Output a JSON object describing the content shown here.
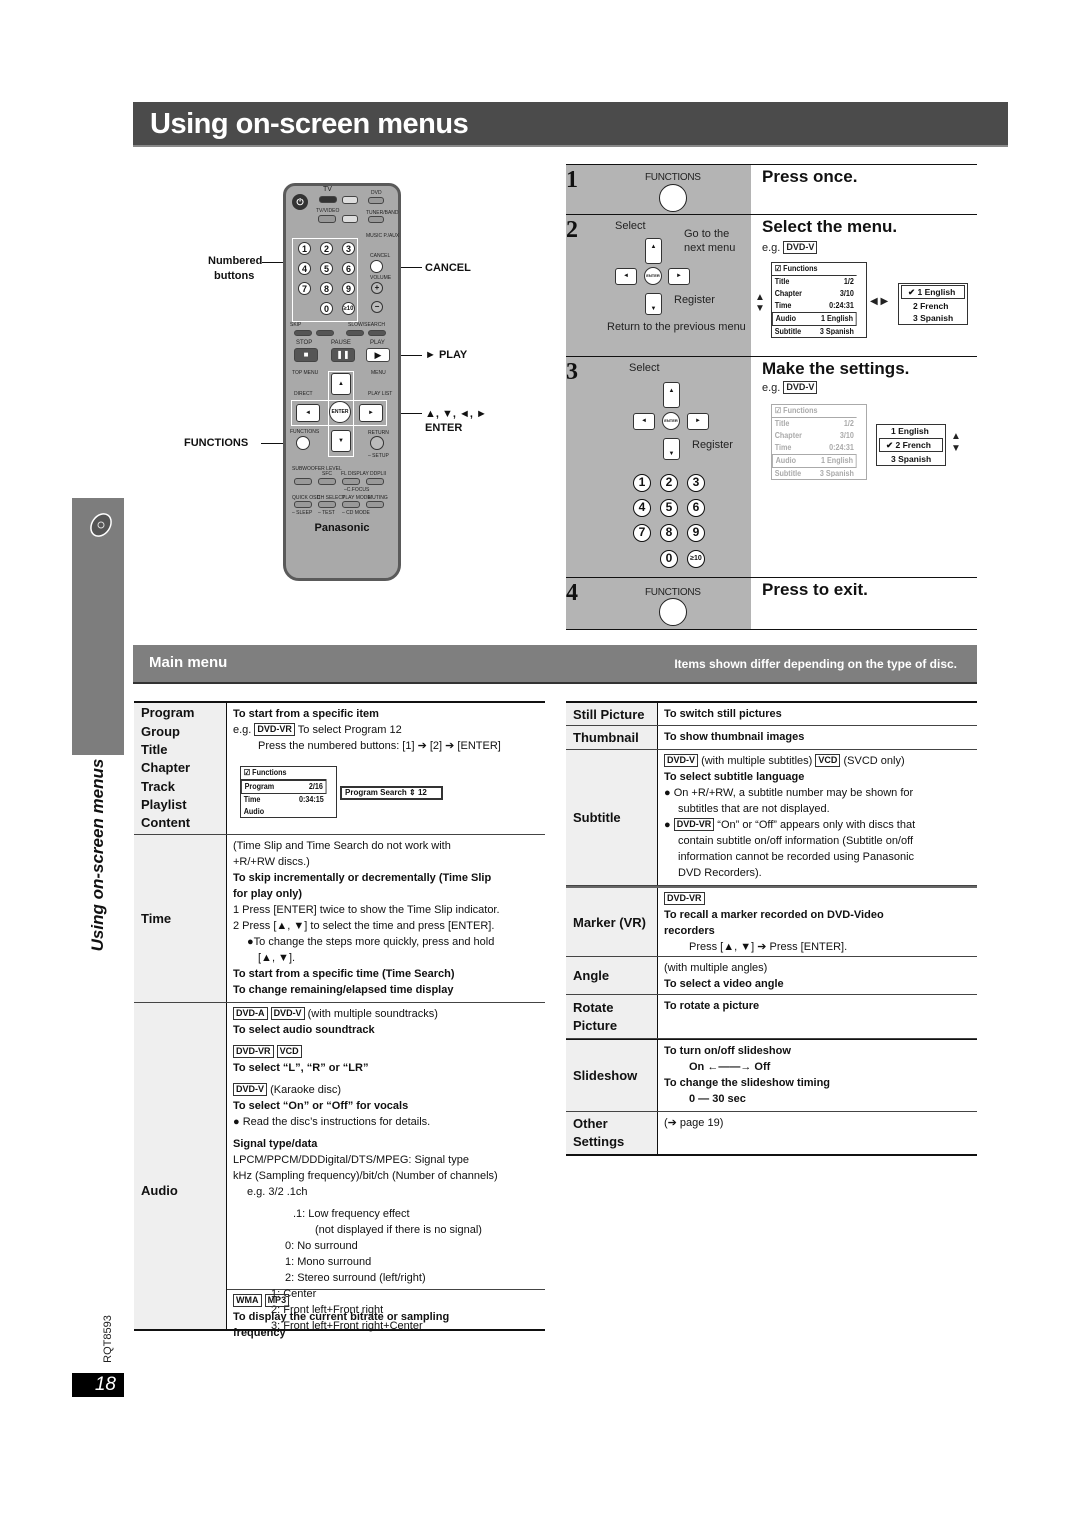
{
  "page": {
    "title": "Using on-screen menus",
    "side_label": "Using on-screen menus",
    "doc_code": "RQT8593",
    "page_number": "18"
  },
  "remote": {
    "callouts": {
      "numbered": "Numbered",
      "buttons": "buttons",
      "cancel": "CANCEL",
      "play": "► PLAY",
      "arrows": "▲, ▼, ◄, ►",
      "enter": "ENTER",
      "functions": "FUNCTIONS"
    },
    "brand": "Panasonic",
    "labels": {
      "tv": "TV",
      "dvd": "DVD",
      "tuner": "TUNER/BAND",
      "music": "MUSIC P./AUX",
      "cancel": "CANCEL",
      "volume": "VOLUME",
      "tvvideo": "TV/VIDEO",
      "skip": "SKIP",
      "slow": "SLOW/SEARCH",
      "stop": "STOP",
      "pause": "PAUSE",
      "play": "PLAY",
      "topmenu": "TOP MENU",
      "menu": "MENU",
      "direct": "DIRECT",
      "playlist": "PLAY LIST",
      "functions": "FUNCTIONS",
      "return": "RETURN",
      "setup": "– SETUP",
      "sub": "SUBWOOFER LEVEL",
      "sfc": "SFC",
      "fl": "FL DISPLAY",
      "pl2": "DDPLII",
      "cfocus": "–C.FOCUS",
      "quick": "QUICK OSD",
      "ch": "CH SELECT",
      "pmode": "PLAY MODE",
      "muting": "MUTING",
      "sleep": "– SLEEP",
      "test": "– TEST",
      "cdmode": "– CD MODE",
      "enter": "ENTER"
    },
    "digits": [
      "1",
      "2",
      "3",
      "4",
      "5",
      "6",
      "7",
      "8",
      "9",
      "0",
      "≥10"
    ]
  },
  "steps": [
    {
      "num": "1",
      "button": "FUNCTIONS",
      "title": "Press once."
    },
    {
      "num": "2",
      "title": "Select the menu.",
      "select": "Select",
      "go_next": "Go to the next menu",
      "register": "Register",
      "return_prev": "Return to the previous menu",
      "eg": "e.g.",
      "disc": "DVD-V",
      "osd": {
        "header": "Functions",
        "rows": [
          [
            "Title",
            "1/2"
          ],
          [
            "Chapter",
            "3/10"
          ],
          [
            "Time",
            "0:24:31"
          ],
          [
            "Audio",
            "1 English"
          ],
          [
            "Subtitle",
            "3 Spanish"
          ]
        ]
      },
      "options": [
        "✔ 1 English",
        "2 French",
        "3 Spanish"
      ]
    },
    {
      "num": "3",
      "title": "Make the settings.",
      "select": "Select",
      "register": "Register",
      "eg": "e.g.",
      "disc": "DVD-V",
      "options": [
        "1 English",
        "✔ 2 French",
        "3 Spanish"
      ],
      "digits": [
        "1",
        "2",
        "3",
        "4",
        "5",
        "6",
        "7",
        "8",
        "9",
        "0",
        "≥10"
      ]
    },
    {
      "num": "4",
      "button": "FUNCTIONS",
      "title": "Press to exit."
    }
  ],
  "main_menu": {
    "title": "Main menu",
    "note": "Items shown differ depending on the type of disc."
  },
  "left_table": {
    "program": {
      "labels": [
        "Program",
        "Group",
        "Title",
        "Chapter",
        "Track",
        "Playlist",
        "Content"
      ],
      "heading": "To start from a specific item",
      "eg": "e.g.",
      "disc": "DVD-VR",
      "eg_text": "To select Program 12",
      "press": "Press the numbered buttons: [1] ➔ [2] ➔ [ENTER]",
      "osd": {
        "header": "Functions",
        "rows": [
          [
            "Program",
            "2/16"
          ],
          [
            "Time",
            "0:34:15"
          ],
          [
            "Audio",
            ""
          ]
        ],
        "search": "Program Search ⇕ 12"
      }
    },
    "time": {
      "label": "Time",
      "note1": "(Time Slip and Time Search do not work with",
      "note2": "+R/+RW discs.)",
      "h1": "To skip incrementally or decrementally (Time Slip",
      "h1b": "for play only)",
      "s1": "1   Press [ENTER] twice to show the Time Slip indicator.",
      "s2": "2   Press [▲, ▼] to select the time and press [ENTER].",
      "s3": "●To change the steps more quickly, press and hold",
      "s3b": "[▲, ▼].",
      "h2": "To start from a specific time (Time Search)",
      "h3": "To change remaining/elapsed time display"
    },
    "audio": {
      "label": "Audio",
      "d1a": "DVD-A",
      "d1b": "DVD-V",
      "t1": "(with multiple soundtracks)",
      "h1": "To select audio soundtrack",
      "d2a": "DVD-VR",
      "d2b": "VCD",
      "h2": "To select “L”, “R” or “LR”",
      "d3": "DVD-V",
      "t3": "(Karaoke disc)",
      "h3": "To select “On” or “Off” for vocals",
      "b3": "● Read the disc’s instructions for details.",
      "h4": "Signal type/data",
      "l1": "LPCM/PPCM/DDDigital/DTS/MPEG:  Signal type",
      "l2": "kHz (Sampling frequency)/bit/ch (Number of channels)",
      "eg": "e.g.  3/2 .1ch",
      "x1": ".1:  Low frequency effect",
      "x2": "(not displayed if there is no signal)",
      "x3": "0:  No surround",
      "x4": "1:  Mono surround",
      "x5": "2:  Stereo surround (left/right)",
      "x6": "1:  Center",
      "x7": "2:  Front left+Front right",
      "x8": "3:  Front left+Front right+Center",
      "d5a": "WMA",
      "d5b": "MP3",
      "h5": "To display the current bitrate or sampling",
      "h5b": "frequency"
    }
  },
  "right_table": [
    {
      "label": "Still Picture",
      "lines": [
        {
          "t": "To switch still pictures",
          "b": true
        }
      ]
    },
    {
      "label": "Thumbnail",
      "lines": [
        {
          "t": "To show thumbnail images",
          "b": true
        }
      ]
    },
    {
      "label": "Subtitle",
      "tag1": "DVD-V",
      "t1": "(with multiple subtitles)",
      "tag2": "VCD",
      "t2": "(SVCD only)",
      "h": "To select subtitle language",
      "p1": "● On +R/+RW, a subtitle number may be shown for",
      "p1b": "subtitles that are not displayed.",
      "tag3": "DVD-VR",
      "p2": "“On” or “Off” appears only with discs that",
      "p2b": "contain subtitle on/off information (Subtitle on/off",
      "p2c": "information cannot be recorded using Panasonic",
      "p2d": "DVD Recorders)."
    },
    {
      "label": "Marker (VR)",
      "tag": "DVD-VR",
      "h": "To recall a marker recorded on DVD-Video",
      "hb": "recorders",
      "p": "Press [▲, ▼] ➔ Press [ENTER]."
    },
    {
      "label": "Angle",
      "t": "(with multiple angles)",
      "h": "To select a video angle"
    },
    {
      "label": "Rotate",
      "label2": "Picture",
      "h": "To rotate a picture"
    },
    {
      "label": "Slideshow",
      "h1": "To turn on/off slideshow",
      "v1": "On ←——→ Off",
      "h2": "To change the slideshow timing",
      "v2": "0 — 30 sec"
    },
    {
      "label": "Other",
      "label2": "Settings",
      "t": "(➔ page 19)"
    }
  ]
}
